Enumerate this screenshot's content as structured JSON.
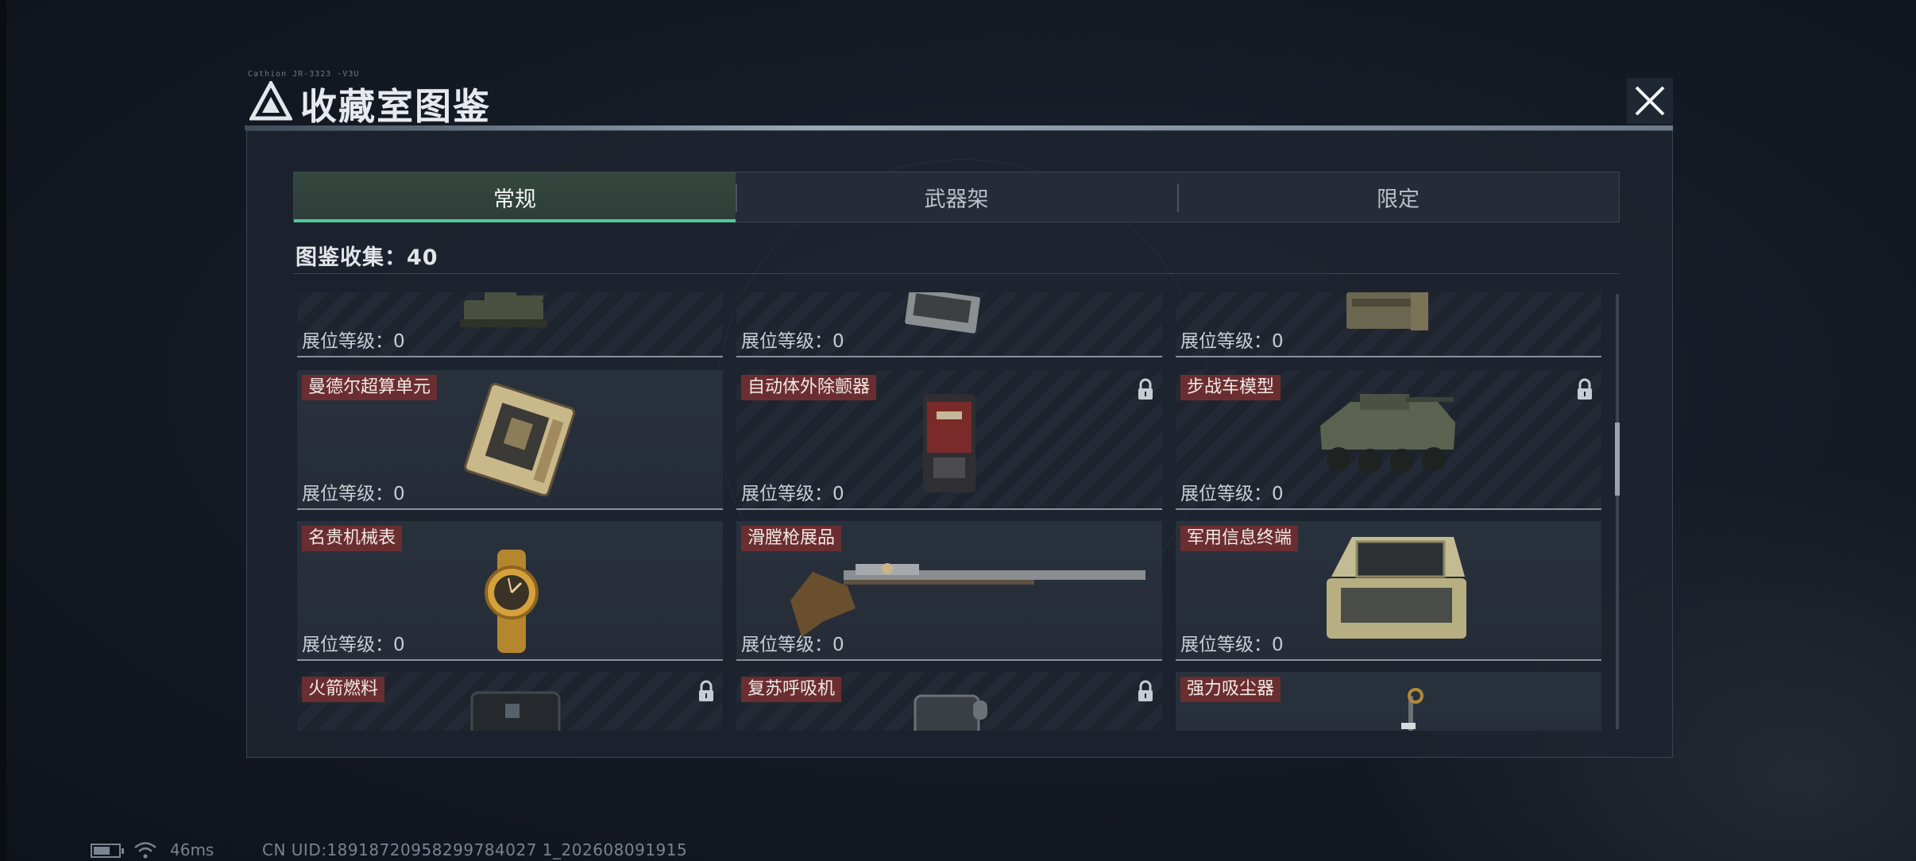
{
  "window": {
    "title": "收藏室图鉴",
    "tiny_caption": "Cathion JR-3323 ·V3U"
  },
  "tabs": [
    {
      "label": "常规",
      "active": true
    },
    {
      "label": "武器架",
      "active": false
    },
    {
      "label": "限定",
      "active": false
    }
  ],
  "collection": {
    "text": "图鉴收集：40"
  },
  "level_prefix": "展位等级：",
  "cards": [
    {
      "name": "",
      "level": "0",
      "locked": false,
      "lit": false,
      "art": "tank-model"
    },
    {
      "name": "",
      "level": "0",
      "locked": false,
      "lit": false,
      "art": "device-box"
    },
    {
      "name": "",
      "level": "0",
      "locked": false,
      "lit": false,
      "art": "ammo-crate"
    },
    {
      "name": "曼德尔超算单元",
      "level": "0",
      "locked": false,
      "lit": true,
      "art": "supercomputer-chip"
    },
    {
      "name": "自动体外除颤器",
      "level": "0",
      "locked": true,
      "lit": false,
      "art": "defibrillator"
    },
    {
      "name": "步战车模型",
      "level": "0",
      "locked": true,
      "lit": false,
      "art": "ifv-model"
    },
    {
      "name": "名贵机械表",
      "level": "0",
      "locked": false,
      "lit": true,
      "art": "gold-watch"
    },
    {
      "name": "滑膛枪展品",
      "level": "0",
      "locked": false,
      "lit": true,
      "art": "musket"
    },
    {
      "name": "军用信息终端",
      "level": "0",
      "locked": false,
      "lit": true,
      "art": "military-terminal"
    },
    {
      "name": "火箭燃料",
      "level": "",
      "locked": true,
      "lit": false,
      "art": "rocket-fuel"
    },
    {
      "name": "复苏呼吸机",
      "level": "",
      "locked": true,
      "lit": false,
      "art": "ventilator"
    },
    {
      "name": "强力吸尘器",
      "level": "",
      "locked": false,
      "lit": true,
      "art": "vacuum"
    }
  ],
  "status": {
    "battery_fraction": 0.7,
    "ping": "46ms",
    "uid": "CN UID:18918720958299784027 1_202608091915"
  },
  "colors": {
    "accent_green": "#55c79a",
    "label_red": "#6b2e30"
  }
}
